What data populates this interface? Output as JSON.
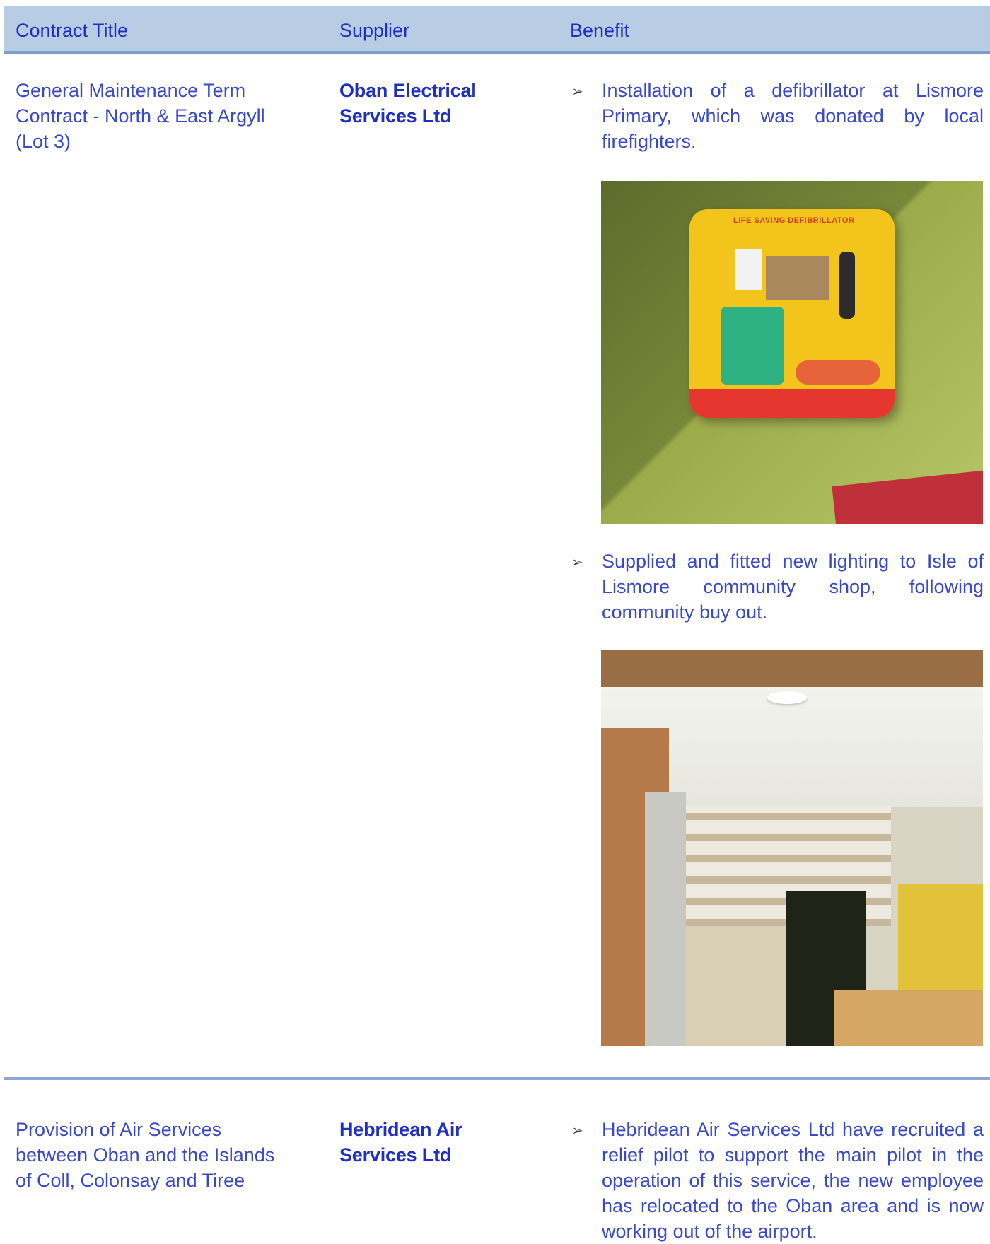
{
  "table": {
    "headers": {
      "contract_title": "Contract Title",
      "supplier": "Supplier",
      "benefit": "Benefit"
    },
    "rows": [
      {
        "contract_title": "General Maintenance Term Contract - North & East Argyll (Lot 3)",
        "supplier": "Oban Electrical Services Ltd",
        "benefits": [
          "Installation of a defibrillator at Lismore Primary, which was donated by local firefighters.",
          "Supplied and fitted new lighting to Isle of Lismore community shop, following community buy out."
        ]
      },
      {
        "contract_title": "Provision of Air Services between Oban and the Islands of Coll, Colonsay and Tiree",
        "supplier": "Hebridean Air Services Ltd",
        "benefits": [
          "Hebridean Air Services Ltd have recruited a relief pilot to support the main pilot in the operation of this service, the new employee has relocated to the Oban area and is now working out of the airport."
        ]
      }
    ]
  },
  "bullet_glyph": "➢",
  "images": {
    "defibrillator_label": "LIFE SAVING DEFIBRILLATOR"
  },
  "colors": {
    "header_bg": "#b8cce4",
    "text_blue": "#3a49c8",
    "separator": "#8aa6d2"
  }
}
